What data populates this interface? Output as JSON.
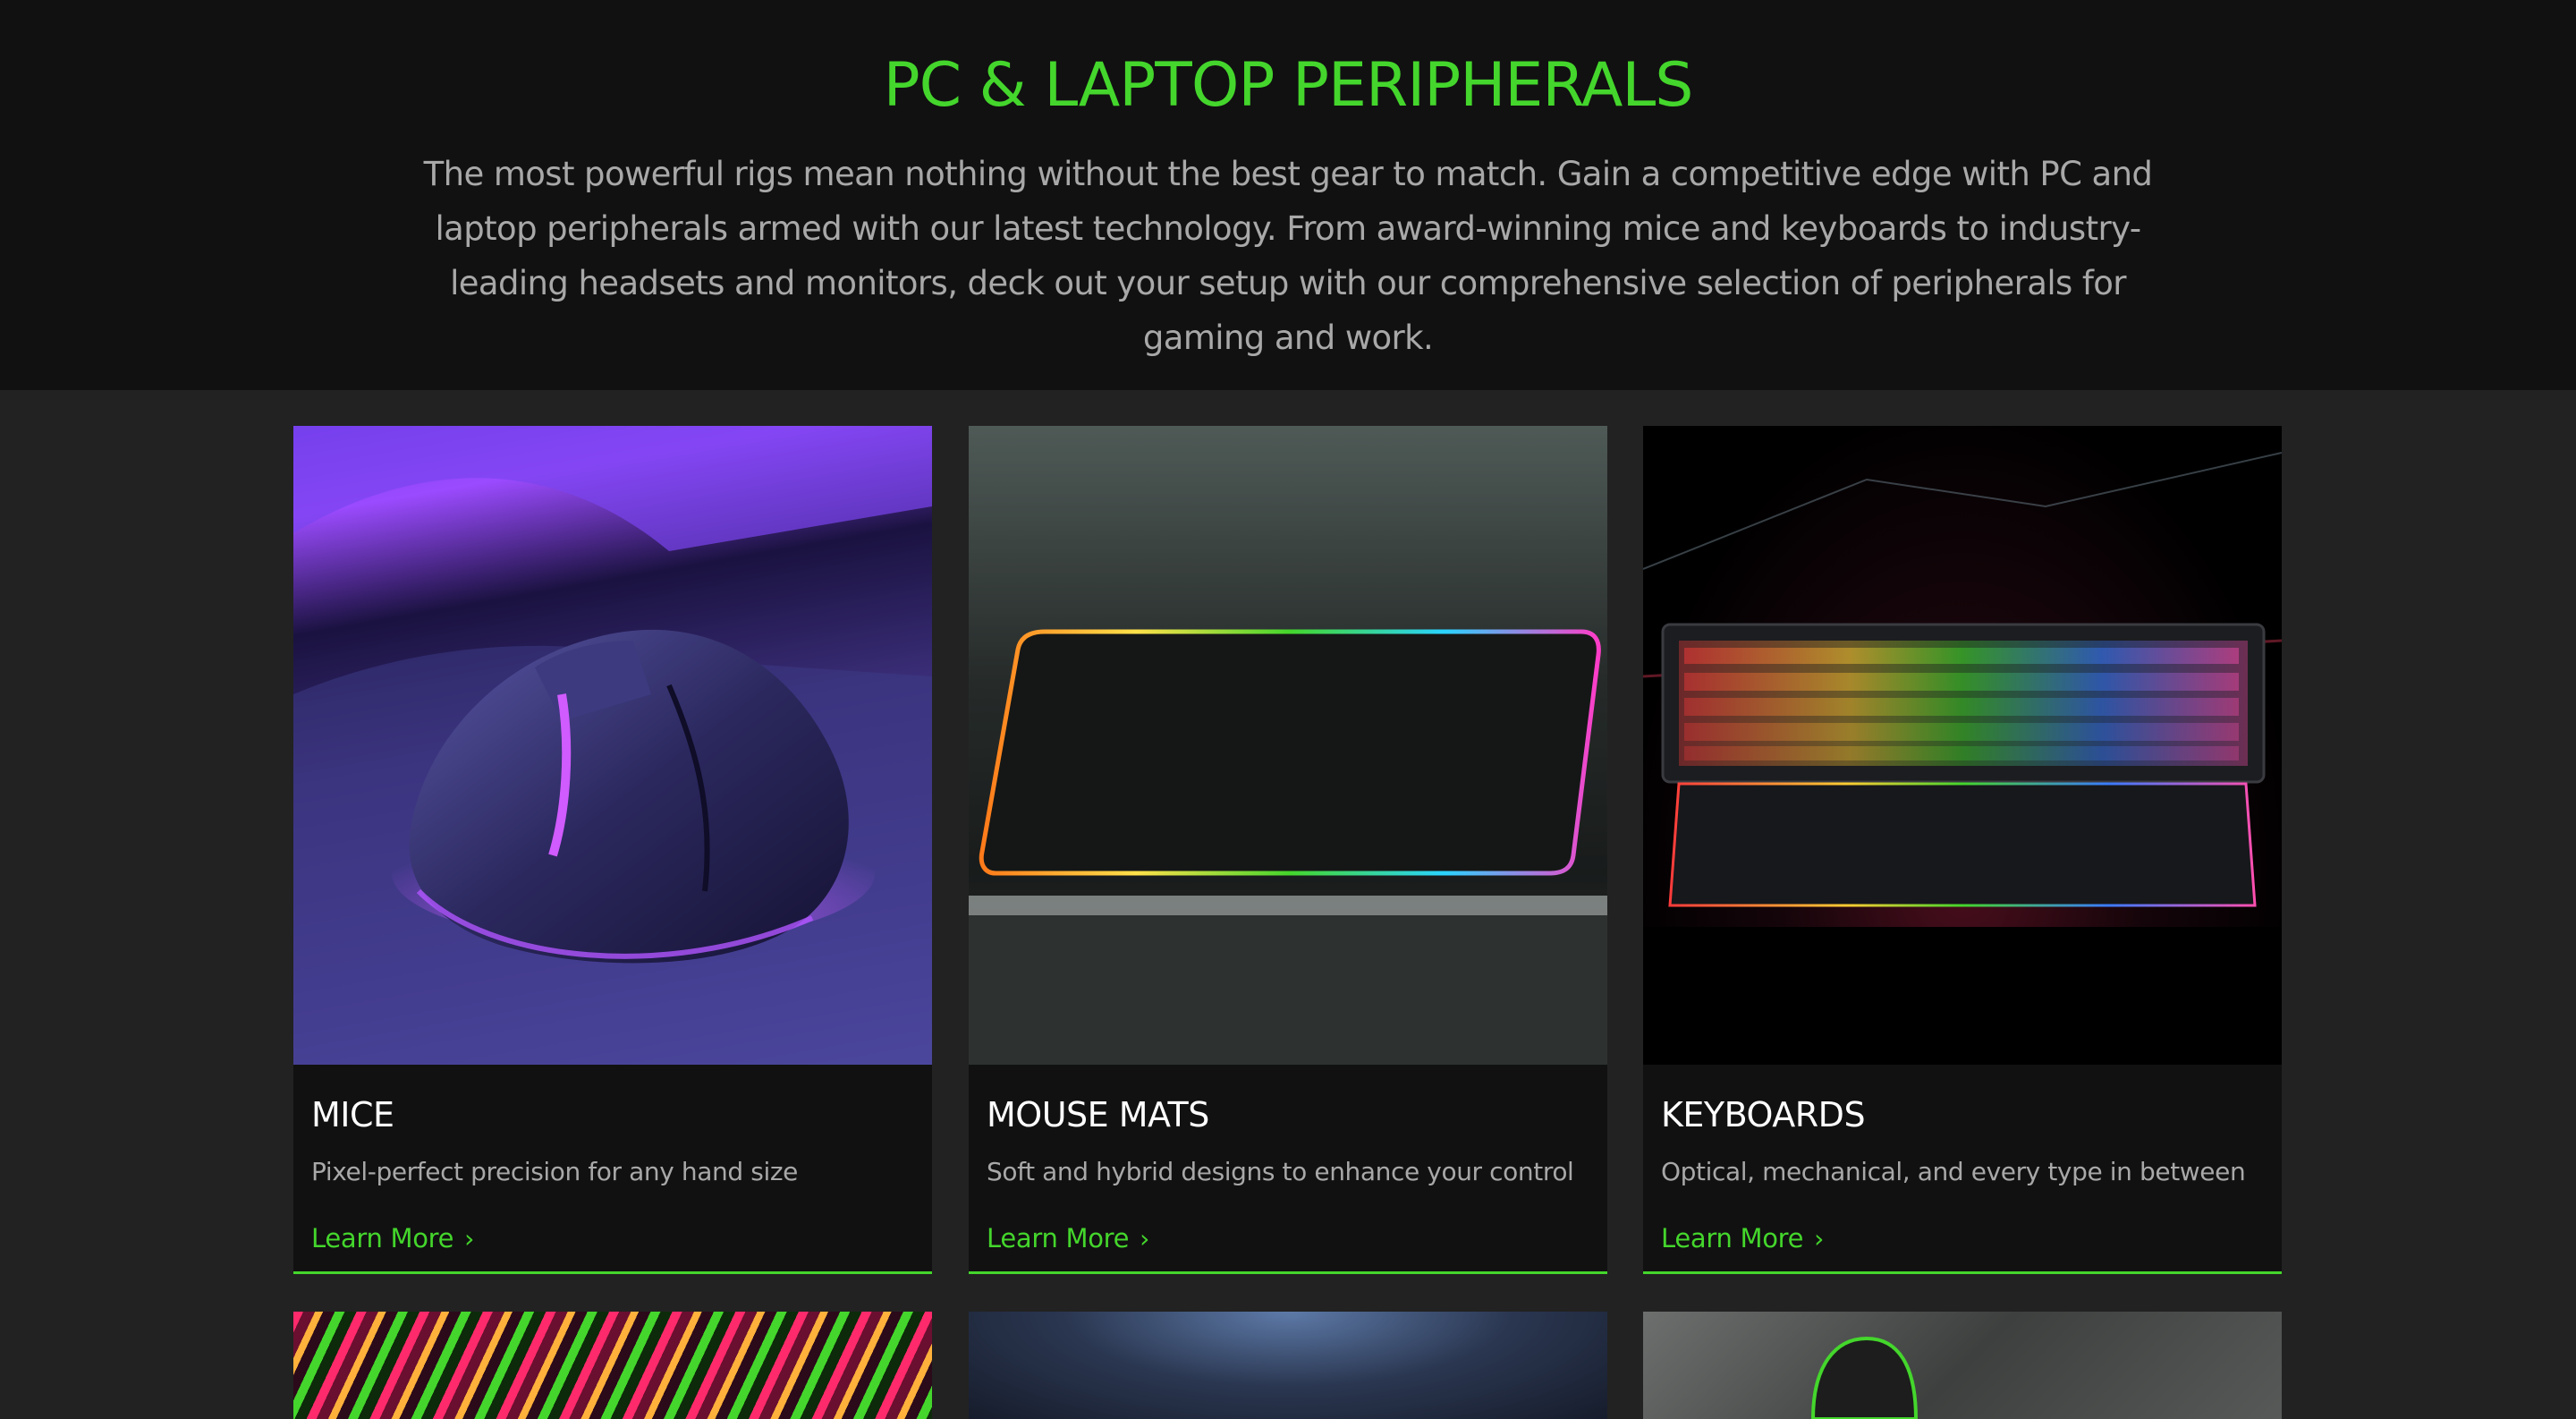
{
  "hero": {
    "title": "PC & LAPTOP PERIPHERALS",
    "description": "The most powerful rigs mean nothing without the best gear to match. Gain a competitive edge with PC and laptop peripherals armed with our latest technology. From award-winning mice and keyboards to industry-leading headsets and monitors, deck out your setup with our comprehensive selection of peripherals for gaming and work."
  },
  "cards": [
    {
      "title": "MICE",
      "description": "Pixel-perfect precision for any hand size",
      "link": "Learn More"
    },
    {
      "title": "MOUSE MATS",
      "description": "Soft and hybrid designs to enhance your control",
      "link": "Learn More"
    },
    {
      "title": "KEYBOARDS",
      "description": "Optical, mechanical, and every type in between",
      "link": "Learn More"
    }
  ],
  "colors": {
    "accent": "#44d62c",
    "hero_bg": "#111111",
    "page_bg": "#222222",
    "text_muted": "#a8a8a8"
  },
  "icons": {
    "link_arrow": "chevron-right-icon"
  }
}
